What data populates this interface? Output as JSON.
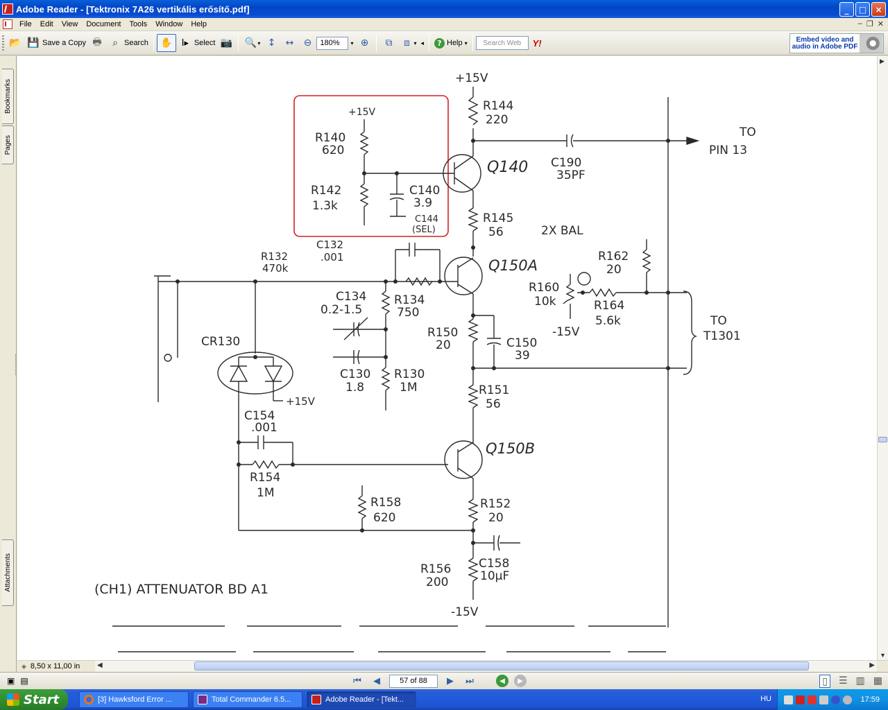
{
  "window": {
    "title": "Adobe Reader - [Tektronix 7A26 vertikális erősítő.pdf]",
    "buttons": {
      "minimize": "_",
      "maximize": "□",
      "close": "×"
    }
  },
  "menu": {
    "items": [
      "File",
      "Edit",
      "View",
      "Document",
      "Tools",
      "Window",
      "Help"
    ]
  },
  "toolbar": {
    "save_copy": "Save a Copy",
    "search": "Search",
    "select": "Select",
    "zoom_value": "180%",
    "help": "Help",
    "search_web_placeholder": "Search Web",
    "yahoo": "Y!",
    "embed_ad": "Embed video and audio in Adobe PDF"
  },
  "side_tabs": {
    "bookmarks": "Bookmarks",
    "pages": "Pages",
    "attachments": "Attachments"
  },
  "status": {
    "page_size": "8,50 x 11,00 in",
    "page_indicator": "57 of 88"
  },
  "schematic": {
    "labels": {
      "plus15_top": "+15V",
      "r144": "R144",
      "r144_val": "220",
      "to_pin13_a": "TO",
      "to_pin13_b": "PIN 13",
      "c190": "C190",
      "c190_val": "35PF",
      "q140": "Q140",
      "box_plus15": "+15V",
      "r140": "R140",
      "r140_val": "620",
      "r142": "R142",
      "r142_val": "1.3k",
      "c140": "C140",
      "c140_val": "3.9",
      "c144": "C144",
      "c144_val": "(SEL)",
      "r145": "R145",
      "r145_val": "56",
      "bal": "2X BAL",
      "c132": "C132",
      "c132_val": ".001",
      "r132": "R132",
      "r132_val": "470k",
      "q150a": "Q150A",
      "r162": "R162",
      "r162_val": "20",
      "r160": "R160",
      "r160_val": "10k",
      "r164": "R164",
      "r164_val": "5.6k",
      "minus15_mid": "-15V",
      "to_t1301_a": "TO",
      "to_t1301_b": "T1301",
      "c134": "C134",
      "c134_val": "0.2-1.5",
      "r134": "R134",
      "r134_val": "750",
      "r150": "R150",
      "r150_val": "20",
      "c150": "C150",
      "c150_val": "39",
      "cr130": "CR130",
      "c130": "C130",
      "c130_val": "1.8",
      "r130": "R130",
      "r130_val": "1M",
      "plus15_cr": "+15V",
      "r151": "R151",
      "r151_val": "56",
      "c154": "C154",
      "c154_val": ".001",
      "q150b": "Q150B",
      "r154": "R154",
      "r154_val": "1M",
      "r158": "R158",
      "r158_val": "620",
      "r152": "R152",
      "r152_val": "20",
      "r156": "R156",
      "r156_val": "200",
      "c158": "C158",
      "c158_val": "10µF",
      "minus15_bot": "-15V",
      "caption": "(CH1) ATTENUATOR BD A1"
    }
  },
  "taskbar": {
    "start": "Start",
    "tasks": [
      "[3] Hawksford Error ...",
      "Total Commander 6.5...",
      "Adobe Reader - [Tekt..."
    ],
    "language": "HU",
    "clock": "17:59"
  },
  "colors": {
    "highlight_box": "#d42020",
    "titlebar": "#0a4dd0"
  }
}
